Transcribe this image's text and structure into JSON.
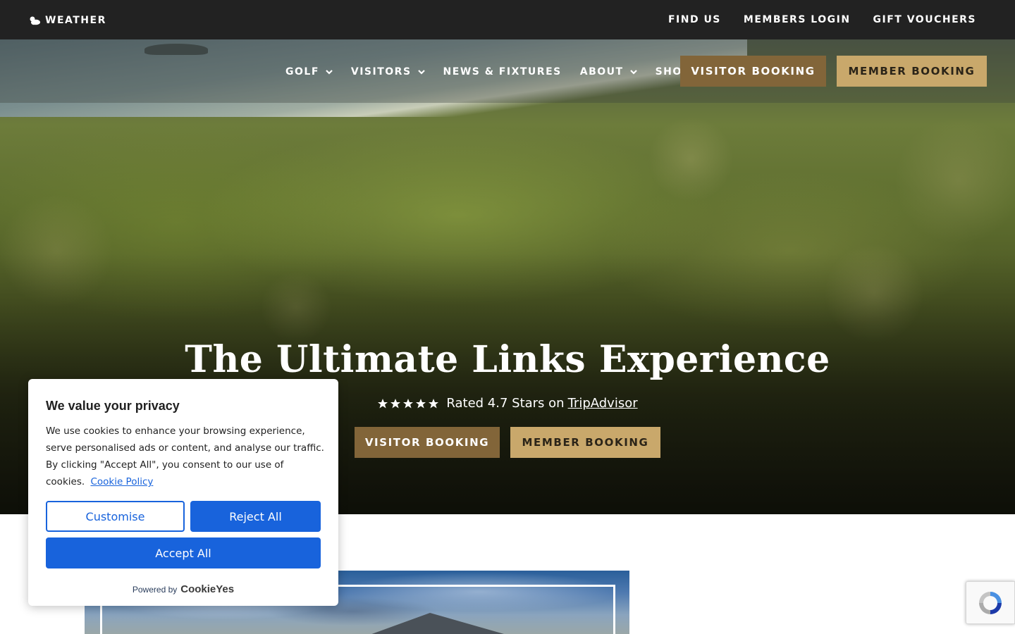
{
  "topbar": {
    "weather_label": "WEATHER",
    "links": [
      "FIND US",
      "MEMBERS LOGIN",
      "GIFT VOUCHERS"
    ]
  },
  "nav": {
    "items": [
      {
        "label": "GOLF",
        "has_dropdown": true
      },
      {
        "label": "VISITORS",
        "has_dropdown": true
      },
      {
        "label": "NEWS & FIXTURES",
        "has_dropdown": false
      },
      {
        "label": "ABOUT",
        "has_dropdown": true
      },
      {
        "label": "SHOP",
        "has_dropdown": false
      }
    ],
    "visitor_booking": "VISITOR BOOKING",
    "member_booking": "MEMBER BOOKING"
  },
  "hero": {
    "title": "The Ultimate Links Experience",
    "rating_text": "Rated 4.7 Stars on",
    "rating_link": "TripAdvisor",
    "stars": 5,
    "visitor_booking": "VISITOR BOOKING",
    "member_booking": "MEMBER BOOKING"
  },
  "cookie": {
    "title": "We value your privacy",
    "body": "We use cookies to enhance your browsing experience, serve personalised ads or content, and analyse our traffic. By clicking \"Accept All\", you consent to our use of cookies.",
    "policy_link": "Cookie Policy",
    "customise": "Customise",
    "reject": "Reject All",
    "accept": "Accept All",
    "powered_by": "Powered by",
    "brand": "CookieYes"
  },
  "colors": {
    "topbar_bg": "#222222",
    "visitor_btn": "#826539",
    "member_btn": "#c9a86b",
    "cookie_accent": "#1863dc"
  }
}
